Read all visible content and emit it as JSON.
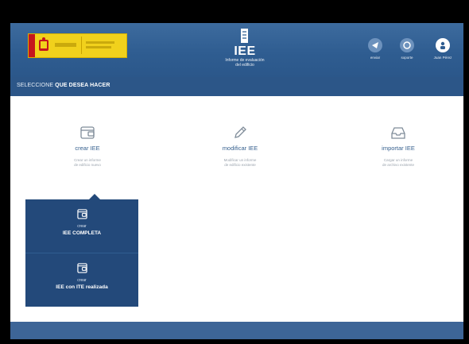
{
  "header": {
    "brand_title": "IEE",
    "brand_subtitle_1": "Informe de evaluación",
    "brand_subtitle_2": "del edificio",
    "buttons": [
      {
        "label": "enviar",
        "icon": "send-icon"
      },
      {
        "label": "soporte",
        "icon": "support-icon"
      },
      {
        "label": "Juan Pérez",
        "icon": "user-icon"
      }
    ]
  },
  "strip": {
    "prefix": "SELECCIONE",
    "bold": "QUE DESEA HACER"
  },
  "options": [
    {
      "title": "crear IEE",
      "desc_1": "Crear un informe",
      "desc_2": "de edificio nuevo",
      "icon": "wallet-icon"
    },
    {
      "title": "modificar IEE",
      "desc_1": "Modificar un informe",
      "desc_2": "de edificio existente",
      "icon": "pencil-icon"
    },
    {
      "title": "importar IEE",
      "desc_1": "Cargar un informe",
      "desc_2": "de archivo existente",
      "icon": "tray-icon"
    }
  ],
  "dropdown": [
    {
      "line1": "crear",
      "line2": "IEE COMPLETA",
      "icon": "wallet-icon"
    },
    {
      "line1": "crear",
      "line2": "IEE con ITE realizada",
      "icon": "wallet-icon"
    }
  ],
  "colors": {
    "header": "#2f5d91",
    "strip": "#2c5688",
    "dropdown": "#23497a",
    "accent": "#37618f",
    "footer": "#3d6597"
  }
}
